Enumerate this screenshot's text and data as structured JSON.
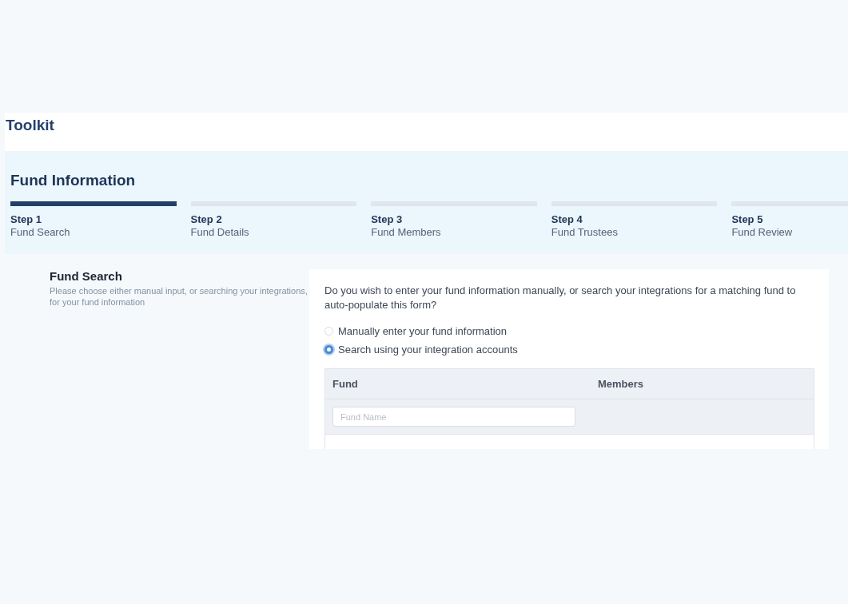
{
  "header": {
    "title": "Toolkit"
  },
  "page_title": "Fund Information",
  "steps": [
    {
      "number": "Step 1",
      "label": "Fund Search",
      "selected": true
    },
    {
      "number": "Step 2",
      "label": "Fund Details",
      "selected": false
    },
    {
      "number": "Step 3",
      "label": "Fund Members",
      "selected": false
    },
    {
      "number": "Step 4",
      "label": "Fund Trustees",
      "selected": false
    },
    {
      "number": "Step 5",
      "label": "Fund Review",
      "selected": false
    }
  ],
  "section": {
    "title": "Fund Search",
    "description": "Please choose either manual input, or searching your integrations, for your fund information"
  },
  "question": "Do you wish to enter your fund information manually, or search your integrations for a matching fund to auto-populate this form?",
  "options": [
    {
      "label": "Manually enter your fund information",
      "selected": false
    },
    {
      "label": "Search using your integration accounts",
      "selected": true
    }
  ],
  "table": {
    "columns": [
      "Fund",
      "Members"
    ],
    "filter": {
      "placeholder": "Fund Name"
    }
  }
}
